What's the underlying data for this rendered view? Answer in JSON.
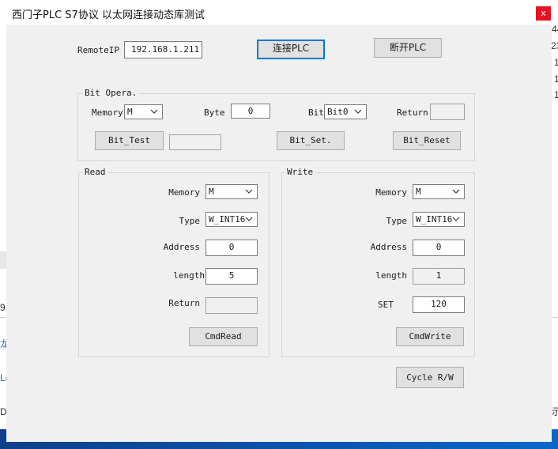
{
  "window": {
    "title": "西门子PLC  S7协议 以太网连接动态库测试",
    "close_glyph": "x"
  },
  "background": {
    "right_fragments": [
      "1",
      "44",
      "23",
      "1",
      "1",
      "1"
    ],
    "left_fragments": [
      "9",
      "龙",
      "L(",
      "De"
    ],
    "right_bottom_fragment": "示"
  },
  "connection": {
    "remote_ip_label": "RemoteIP",
    "remote_ip_value": "192.168.1.211",
    "connect_label": "连接PLC",
    "disconnect_label": "断开PLC"
  },
  "bit_opera": {
    "title": "Bit Opera.",
    "memory_label": "Memory",
    "memory_value": "M",
    "byte_label": "Byte",
    "byte_value": "0",
    "bit_label": "Bit",
    "bit_value": "Bit0",
    "return_label": "Return",
    "return_value": "",
    "test_label": "Bit_Test",
    "test_result": "",
    "set_label": "Bit_Set.",
    "reset_label": "Bit_Reset"
  },
  "read": {
    "title": "Read",
    "memory_label": "Memory",
    "memory_value": "M",
    "type_label": "Type",
    "type_value": "W_INT16",
    "address_label": "Address",
    "address_value": "0",
    "length_label": "length",
    "length_value": "5",
    "return_label": "Return",
    "return_value": "",
    "button_label": "CmdRead"
  },
  "write": {
    "title": "Write",
    "memory_label": "Memory",
    "memory_value": "M",
    "type_label": "Type",
    "type_value": "W_INT16",
    "address_label": "Address",
    "address_value": "0",
    "length_label": "length",
    "length_value": "1",
    "set_label": "SET",
    "set_value": "120",
    "button_label": "CmdWrite"
  },
  "cycle": {
    "button_label": "Cycle R/W"
  }
}
